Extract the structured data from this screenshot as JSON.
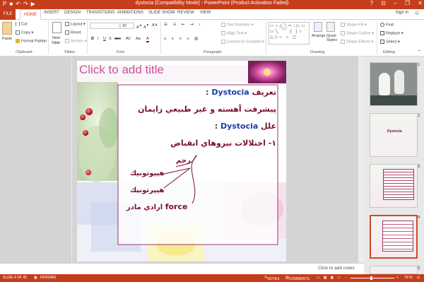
{
  "titlebar": {
    "title": "dystocia [Compatibility Mode] - PowerPoint (Product Activation Failed)",
    "window_controls": "? ⊡ – ❐ ✕"
  },
  "tabs": {
    "file": "FILE",
    "home": "HOME",
    "insert": "INSERT",
    "design": "DESIGN",
    "transitions": "TRANSITIONS",
    "animations": "ANIMATIONS",
    "slideshow": "SLIDE SHOW",
    "review": "REVIEW",
    "view": "VIEW",
    "signin": "Sign in"
  },
  "ribbon": {
    "clipboard": {
      "paste": "Paste",
      "cut": "Cut",
      "copy": "Copy",
      "painter": "Format Painter",
      "label": "Clipboard"
    },
    "slides": {
      "new_slide": "New",
      "new_slide2": "Slide",
      "layout": "Layout",
      "reset": "Reset",
      "section": "Section",
      "label": "Slides"
    },
    "font": {
      "size": "32",
      "label": "Font",
      "bold": "B",
      "italic": "I",
      "underline": "U",
      "strike": "S",
      "shadow": "abc",
      "spacing": "AV",
      "case": "Aa"
    },
    "paragraph": {
      "text_direction": "Text Direction",
      "align_text": "Align Text",
      "convert": "Convert to SmartArt",
      "label": "Paragraph"
    },
    "drawing": {
      "arrange": "Arrange",
      "quick_styles": "Quick Styles",
      "shape_fill": "Shape Fill",
      "shape_outline": "Shape Outline",
      "shape_effects": "Shape Effects",
      "label": "Drawing"
    },
    "editing": {
      "find": "Find",
      "replace": "Replace",
      "select": "Select",
      "label": "Editing"
    }
  },
  "slide": {
    "title_placeholder": "Click to add title",
    "line1_en": "Dystocia",
    "line1_ar": "تعريف",
    "line1_colon": ":",
    "line2": "پيشرفت آهسته و غير طبيعي زايمان",
    "line3_ar": "علل",
    "line3_en": "Dystocia",
    "line3_colon": ":",
    "line4": "١- اختلالات نيروهاي انقباض",
    "label_rahem": "رحم",
    "label_hypotonic": "هيپوتونيك",
    "label_hypertonic": "هيپرتونيك",
    "label_force_en": "force",
    "label_force_ar": "ارادي مادر"
  },
  "thumbnails": [
    {
      "num": "1"
    },
    {
      "num": "2",
      "text": "Dystocia"
    },
    {
      "num": "3"
    },
    {
      "num": "4"
    },
    {
      "num": "5"
    }
  ],
  "notes": {
    "placeholder": "Click to add notes"
  },
  "statusbar": {
    "slide": "SLIDE 4 OF 45",
    "language": "PERSIAN",
    "notes": "NOTES",
    "comments": "COMMENTS",
    "zoom": "70 %"
  },
  "colors": {
    "accent": "#c43e1c",
    "title_pink": "#d2509b",
    "body_maroon": "#7b1030",
    "body_blue": "#1a3fa8"
  }
}
